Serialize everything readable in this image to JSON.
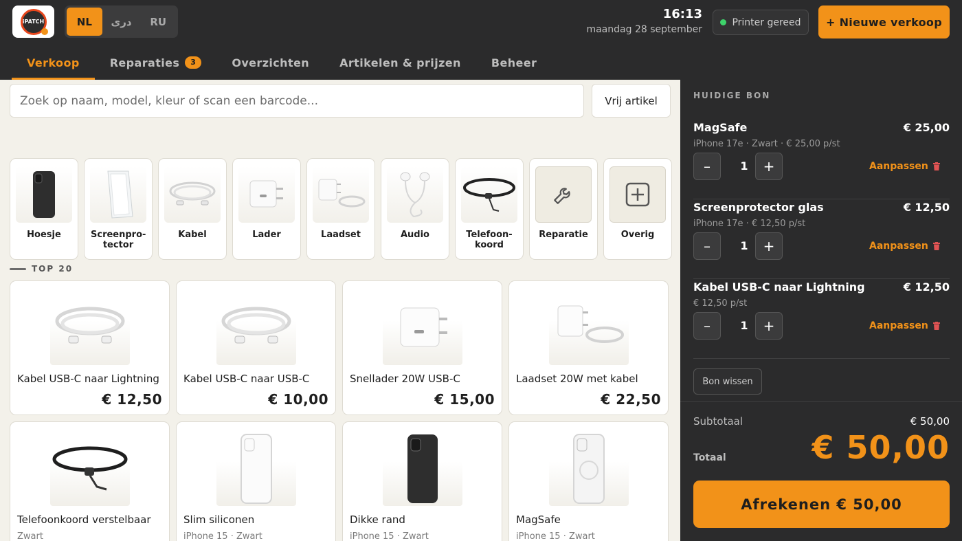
{
  "app": {
    "logo_text": "iPATCH"
  },
  "languages": [
    {
      "label": "NL",
      "active": true
    },
    {
      "label": "دری",
      "active": false
    },
    {
      "label": "RU",
      "active": false
    }
  ],
  "clock": {
    "time": "16:13",
    "date": "maandag 28 september"
  },
  "printer": {
    "label": "Printer gereed",
    "status_color": "#3ed36b"
  },
  "new_sale": {
    "label": "+ Nieuwe verkoop"
  },
  "tabs": [
    {
      "label": "Verkoop",
      "active": true
    },
    {
      "label": "Reparaties",
      "badge": "3"
    },
    {
      "label": "Overzichten"
    },
    {
      "label": "Artikelen & prijzen"
    },
    {
      "label": "Beheer"
    }
  ],
  "search": {
    "placeholder": "Zoek op naam, model, kleur of scan een barcode...",
    "free_item_label": "Vrij artikel"
  },
  "categories": [
    {
      "label": "Hoesje",
      "icon": "phone-case-icon"
    },
    {
      "label": "Screenpro-tector",
      "icon": "screen-protector-icon"
    },
    {
      "label": "Kabel",
      "icon": "cable-icon"
    },
    {
      "label": "Lader",
      "icon": "charger-icon"
    },
    {
      "label": "Laadset",
      "icon": "charger-set-icon"
    },
    {
      "label": "Audio",
      "icon": "earbuds-icon"
    },
    {
      "label": "Telefoon-koord",
      "icon": "lanyard-icon"
    },
    {
      "label": "Reparatie",
      "icon": "wrench-icon"
    },
    {
      "label": "Overig",
      "icon": "plus-box-icon"
    }
  ],
  "section_label": "TOP 20",
  "products": [
    {
      "name": "Kabel USB-C naar Lightning",
      "price": "€ 12,50",
      "icon": "cable-icon"
    },
    {
      "name": "Kabel USB-C naar USB-C",
      "price": "€ 10,00",
      "icon": "cable-icon"
    },
    {
      "name": "Snellader 20W USB-C",
      "price": "€ 15,00",
      "icon": "charger-icon"
    },
    {
      "name": "Laadset 20W met kabel",
      "price": "€ 22,50",
      "icon": "charger-set-icon"
    },
    {
      "name": "Telefoonkoord verstelbaar",
      "sub": "Zwart",
      "icon": "lanyard-icon"
    },
    {
      "name": "Slim siliconen",
      "sub": "iPhone 15 · Zwart",
      "icon": "clear-case-icon"
    },
    {
      "name": "Dikke rand",
      "sub": "iPhone 15 · Zwart",
      "icon": "phone-case-icon"
    },
    {
      "name": "MagSafe",
      "sub": "iPhone 15 · Zwart",
      "icon": "magsafe-case-icon"
    }
  ],
  "receipt": {
    "title": "HUIDIGE BON",
    "lines": [
      {
        "name": "MagSafe",
        "price": "€ 25,00",
        "sub": "iPhone 17e · Zwart · € 25,00 p/st",
        "qty": "1"
      },
      {
        "name": "Screenprotector glas",
        "price": "€ 12,50",
        "sub": "iPhone 17e · € 12,50 p/st",
        "qty": "1"
      },
      {
        "name": "Kabel USB-C naar Lightning",
        "price": "€ 12,50",
        "sub": "€ 12,50 p/st",
        "qty": "1"
      }
    ],
    "minus": "–",
    "plus": "+",
    "adjust_label": "Aanpassen",
    "clear_label": "Bon wissen",
    "subtotal_label": "Subtotaal",
    "subtotal": "€ 50,00",
    "total_label": "Totaal",
    "total": "€ 50,00",
    "checkout_label": "Afrekenen  € 50,00"
  },
  "colors": {
    "accent": "#f29219",
    "dark": "#2b2b2c",
    "trash": "#e05353"
  }
}
